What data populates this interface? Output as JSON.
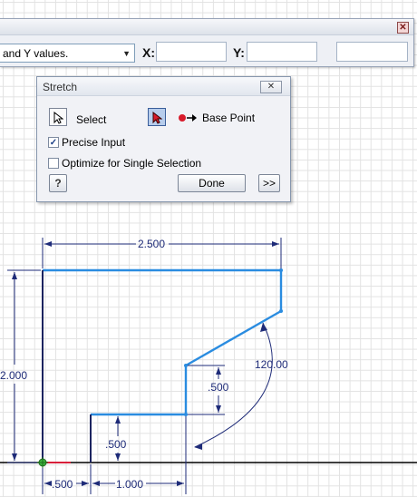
{
  "toolbar": {
    "mode_value": "and Y values.",
    "x_label": "X:",
    "y_label": "Y:",
    "x_value": "",
    "y_value": "",
    "extra_value": "",
    "close_symbol": "✕"
  },
  "stretch_dialog": {
    "title": "Stretch",
    "close_symbol": "✕",
    "select_label": "Select",
    "base_point_label": "Base Point",
    "precise_input_label": "Precise Input",
    "precise_input_checked": true,
    "optimize_label": "Optimize for Single Selection",
    "optimize_checked": false,
    "help_label": "?",
    "done_label": "Done",
    "more_label": ">>"
  },
  "dimensions": {
    "width_top": "2.500",
    "height_left": "2.000",
    "height_step_right": ".500",
    "angle": "120.00",
    "height_step_left": ".500",
    "width_bottom_left": ".500",
    "width_bottom_mid": "1.000"
  },
  "colors": {
    "profile": "#2a8ce0",
    "dimension": "#1e2b78",
    "axis": "#000000",
    "axis_red": "#d8203a",
    "origin": "#3bb33b"
  }
}
